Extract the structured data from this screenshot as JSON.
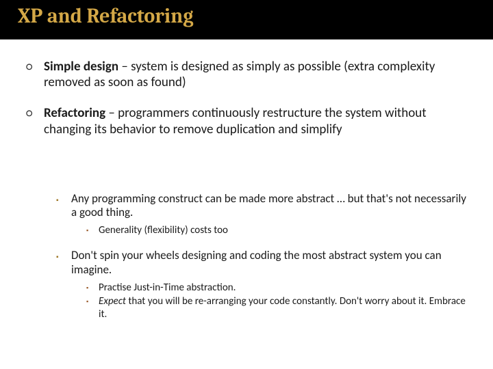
{
  "title": "XP and Refactoring",
  "b1": {
    "term": "Simple design",
    "rest": " – system is designed as simply as possible (extra complexity removed as soon as found)"
  },
  "b2": {
    "term": "Refactoring",
    "rest": " – programmers continuously restructure the system without changing its behavior to remove duplication and simplify"
  },
  "s1": {
    "text": "Any programming construct can be made more abstract … but that's not necessarily a good thing.",
    "sub1": "Generality (flexibility) costs too"
  },
  "s2": {
    "text": "Don't spin your wheels designing and coding the most abstract system you can imagine.",
    "sub1": "Practise Just-in-Time abstraction.",
    "sub2a": "Expect",
    "sub2b": " that you will be re-arranging your code constantly. Don't worry about it. Embrace it."
  },
  "marks": {
    "hollow": "○",
    "sq": "▪"
  }
}
